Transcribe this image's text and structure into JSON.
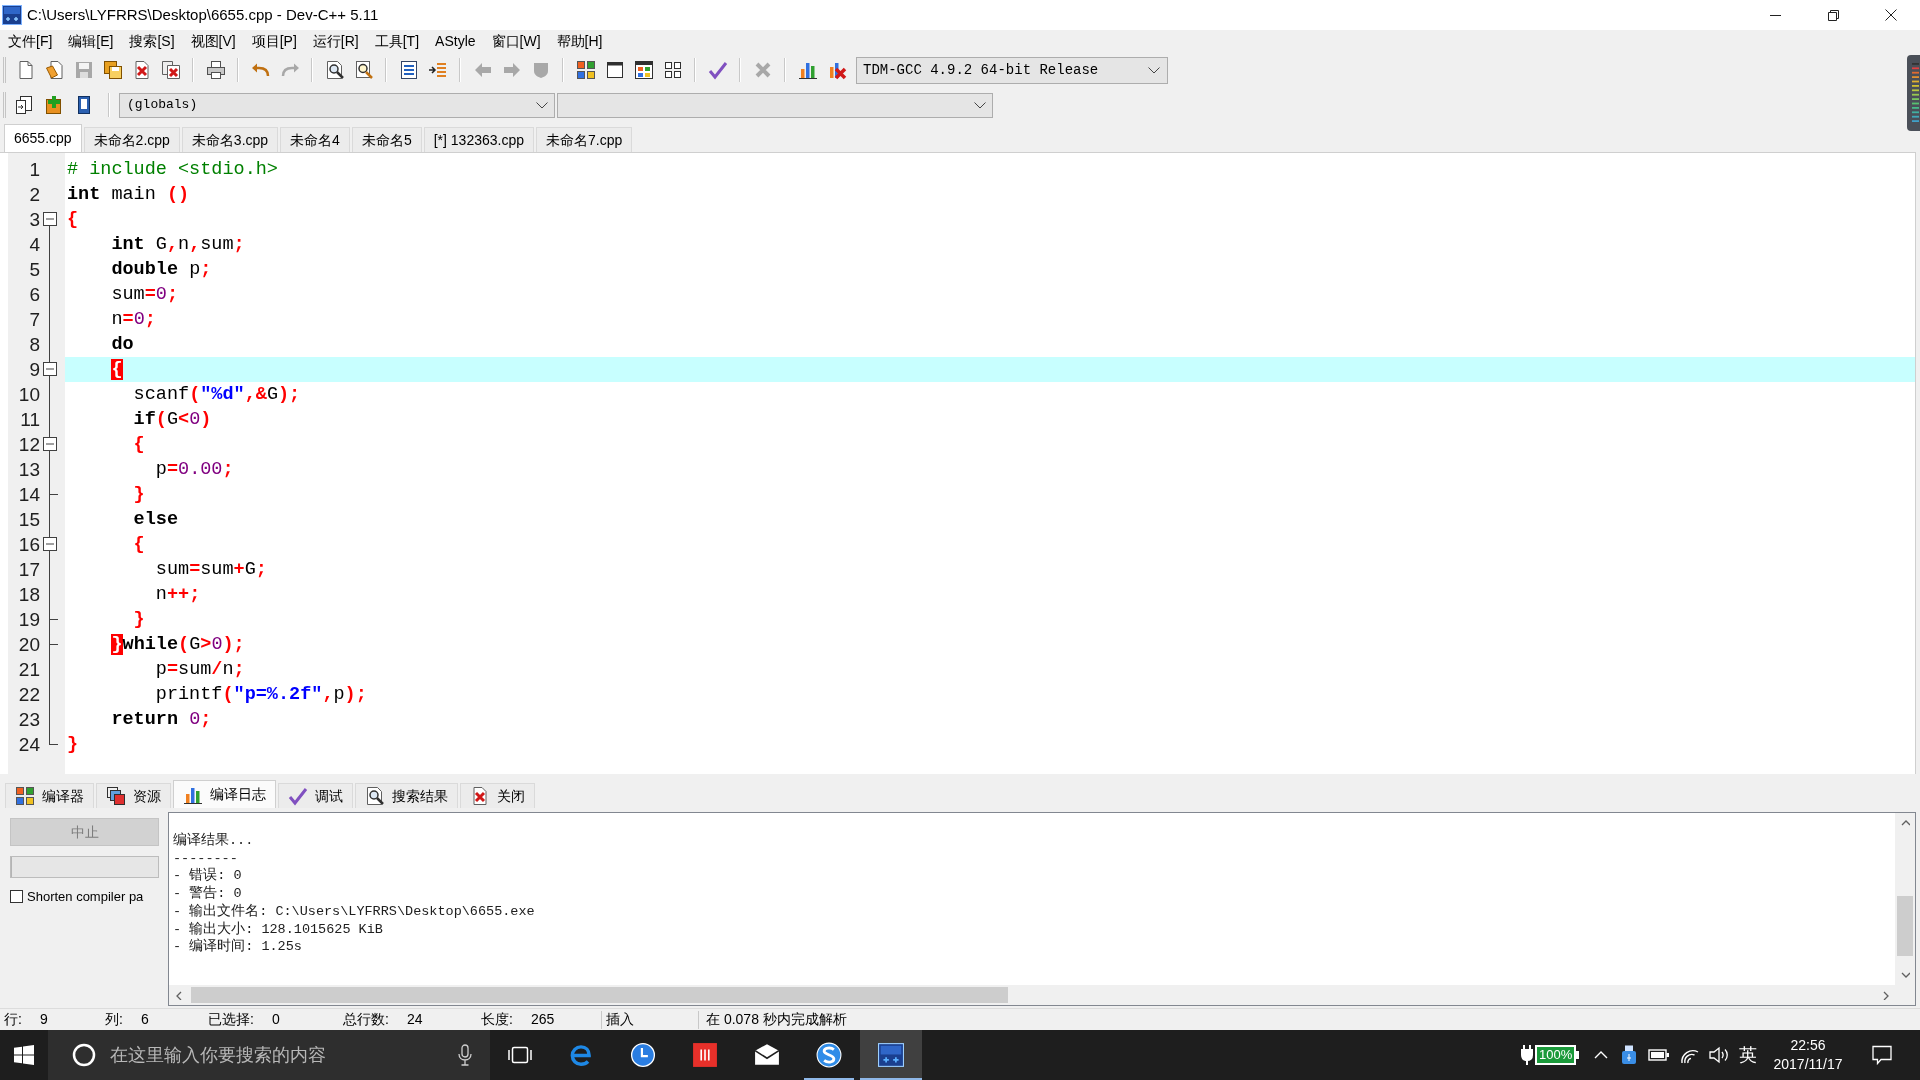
{
  "window": {
    "title": "C:\\Users\\LYFRRS\\Desktop\\6655.cpp - Dev-C++ 5.11"
  },
  "menu": [
    "文件[F]",
    "编辑[E]",
    "搜索[S]",
    "视图[V]",
    "项目[P]",
    "运行[R]",
    "工具[T]",
    "AStyle",
    "窗口[W]",
    "帮助[H]"
  ],
  "toolbar": {
    "groups": [
      [
        {
          "kind": "new",
          "disabled": false
        },
        {
          "kind": "open",
          "disabled": false
        },
        {
          "kind": "save",
          "disabled": true
        },
        {
          "kind": "save_all",
          "disabled": false
        },
        {
          "kind": "close",
          "disabled": false
        },
        {
          "kind": "close_all",
          "disabled": false
        }
      ],
      [
        {
          "kind": "print",
          "disabled": false
        }
      ],
      [
        {
          "kind": "undo",
          "disabled": false
        },
        {
          "kind": "redo",
          "disabled": true
        }
      ],
      [
        {
          "kind": "find",
          "disabled": false
        },
        {
          "kind": "replace",
          "disabled": false
        }
      ],
      [
        {
          "kind": "indent",
          "disabled": false
        },
        {
          "kind": "unindent",
          "disabled": false
        }
      ],
      [
        {
          "kind": "bookmark_prev",
          "disabled": true
        },
        {
          "kind": "bookmark_next",
          "disabled": true
        },
        {
          "kind": "bookmark_toggle",
          "disabled": true
        }
      ],
      [
        {
          "kind": "compile",
          "disabled": false
        },
        {
          "kind": "run",
          "disabled": false
        },
        {
          "kind": "compile_run",
          "disabled": false
        },
        {
          "kind": "rebuild",
          "disabled": false
        }
      ],
      [
        {
          "kind": "syntax_check",
          "disabled": false
        }
      ],
      [
        {
          "kind": "stop",
          "disabled": true
        }
      ],
      [
        {
          "kind": "profile",
          "disabled": false
        },
        {
          "kind": "delete_profile",
          "disabled": false
        }
      ]
    ],
    "compiler": "TDM-GCC 4.9.2 64-bit Release"
  },
  "toolbar_2": {
    "buttons": [
      {
        "kind": "insert",
        "disabled": false
      },
      {
        "kind": "add_file",
        "disabled": false
      },
      {
        "kind": "bookmarks",
        "disabled": false
      }
    ],
    "scope": "(globals)"
  },
  "file_tabs": [
    {
      "label": "6655.cpp",
      "selected": true
    },
    {
      "label": "未命名2.cpp",
      "selected": false
    },
    {
      "label": "未命名3.cpp",
      "selected": false
    },
    {
      "label": "未命名4",
      "selected": false
    },
    {
      "label": "未命名5",
      "selected": false
    },
    {
      "label": "[*] 132363.cpp",
      "selected": false
    },
    {
      "label": "未命名7.cpp",
      "selected": false
    }
  ],
  "editor": {
    "lines": [
      {
        "number": "1",
        "current": false,
        "kind": "plain",
        "tokens": [
          {
            "text": "# include <stdio.h>",
            "kind": "preproc"
          }
        ]
      },
      {
        "number": "2",
        "current": false,
        "kind": "plain",
        "tokens": [
          {
            "text": "int",
            "kind": "keyword"
          },
          {
            "text": " main ",
            "kind": "ident"
          },
          {
            "text": "()",
            "kind": "symbol"
          }
        ]
      },
      {
        "number": "3",
        "current": false,
        "kind": "head",
        "tokens": [
          {
            "text": "{",
            "kind": "symbol"
          }
        ]
      },
      {
        "number": "4",
        "current": false,
        "kind": "body",
        "tokens": [
          {
            "text": "    int",
            "kind": "keyword"
          },
          {
            "text": " G",
            "kind": "ident"
          },
          {
            "text": ",",
            "kind": "symbol"
          },
          {
            "text": "n",
            "kind": "ident"
          },
          {
            "text": ",",
            "kind": "symbol"
          },
          {
            "text": "sum",
            "kind": "ident"
          },
          {
            "text": ";",
            "kind": "symbol"
          }
        ]
      },
      {
        "number": "5",
        "current": false,
        "kind": "body",
        "tokens": [
          {
            "text": "    double",
            "kind": "keyword"
          },
          {
            "text": " p",
            "kind": "ident"
          },
          {
            "text": ";",
            "kind": "symbol"
          }
        ]
      },
      {
        "number": "6",
        "current": false,
        "kind": "body",
        "tokens": [
          {
            "text": "    sum",
            "kind": "ident"
          },
          {
            "text": "=",
            "kind": "symbol"
          },
          {
            "text": "0",
            "kind": "number"
          },
          {
            "text": ";",
            "kind": "symbol"
          }
        ]
      },
      {
        "number": "7",
        "current": false,
        "kind": "body",
        "tokens": [
          {
            "text": "    n",
            "kind": "ident"
          },
          {
            "text": "=",
            "kind": "symbol"
          },
          {
            "text": "0",
            "kind": "number"
          },
          {
            "text": ";",
            "kind": "symbol"
          }
        ]
      },
      {
        "number": "8",
        "current": false,
        "kind": "body",
        "tokens": [
          {
            "text": "    do",
            "kind": "keyword"
          }
        ]
      },
      {
        "number": "9",
        "current": true,
        "kind": "open",
        "tokens": [
          {
            "text": "    {",
            "kind": "matched_brace"
          }
        ]
      },
      {
        "number": "10",
        "current": false,
        "kind": "body",
        "tokens": [
          {
            "text": "      scanf",
            "kind": "ident"
          },
          {
            "text": "(",
            "kind": "symbol"
          },
          {
            "text": "\"%d\"",
            "kind": "string"
          },
          {
            "text": ",&",
            "kind": "symbol"
          },
          {
            "text": "G",
            "kind": "ident"
          },
          {
            "text": ");",
            "kind": "symbol"
          }
        ]
      },
      {
        "number": "11",
        "current": false,
        "kind": "body",
        "tokens": [
          {
            "text": "      if",
            "kind": "keyword"
          },
          {
            "text": "(",
            "kind": "symbol"
          },
          {
            "text": "G",
            "kind": "ident"
          },
          {
            "text": "<",
            "kind": "symbol"
          },
          {
            "text": "0",
            "kind": "number"
          },
          {
            "text": ")",
            "kind": "symbol"
          }
        ]
      },
      {
        "number": "12",
        "current": false,
        "kind": "open",
        "tokens": [
          {
            "text": "      {",
            "kind": "symbol"
          }
        ]
      },
      {
        "number": "13",
        "current": false,
        "kind": "body",
        "tokens": [
          {
            "text": "        p",
            "kind": "ident"
          },
          {
            "text": "=",
            "kind": "symbol"
          },
          {
            "text": "0.00",
            "kind": "number"
          },
          {
            "text": ";",
            "kind": "symbol"
          }
        ]
      },
      {
        "number": "14",
        "current": false,
        "kind": "tail",
        "tokens": [
          {
            "text": "      }",
            "kind": "symbol"
          }
        ]
      },
      {
        "number": "15",
        "current": false,
        "kind": "body",
        "tokens": [
          {
            "text": "      else",
            "kind": "keyword"
          }
        ]
      },
      {
        "number": "16",
        "current": false,
        "kind": "open",
        "tokens": [
          {
            "text": "      {",
            "kind": "symbol"
          }
        ]
      },
      {
        "number": "17",
        "current": false,
        "kind": "body",
        "tokens": [
          {
            "text": "        sum",
            "kind": "ident"
          },
          {
            "text": "=",
            "kind": "symbol"
          },
          {
            "text": "sum",
            "kind": "ident"
          },
          {
            "text": "+",
            "kind": "symbol"
          },
          {
            "text": "G",
            "kind": "ident"
          },
          {
            "text": ";",
            "kind": "symbol"
          }
        ]
      },
      {
        "number": "18",
        "current": false,
        "kind": "body",
        "tokens": [
          {
            "text": "        n",
            "kind": "ident"
          },
          {
            "text": "++;",
            "kind": "symbol"
          }
        ]
      },
      {
        "number": "19",
        "current": false,
        "kind": "tail",
        "tokens": [
          {
            "text": "      }",
            "kind": "symbol"
          }
        ]
      },
      {
        "number": "20",
        "current": false,
        "kind": "tail",
        "tokens": [
          {
            "text": "    }",
            "kind": "matched_brace"
          },
          {
            "text": "while",
            "kind": "keyword"
          },
          {
            "text": "(",
            "kind": "symbol"
          },
          {
            "text": "G",
            "kind": "ident"
          },
          {
            "text": ">",
            "kind": "symbol"
          },
          {
            "text": "0",
            "kind": "number"
          },
          {
            "text": ");",
            "kind": "symbol"
          }
        ]
      },
      {
        "number": "21",
        "current": false,
        "kind": "body",
        "tokens": [
          {
            "text": "        p",
            "kind": "ident"
          },
          {
            "text": "=",
            "kind": "symbol"
          },
          {
            "text": "sum",
            "kind": "ident"
          },
          {
            "text": "/",
            "kind": "symbol"
          },
          {
            "text": "n",
            "kind": "ident"
          },
          {
            "text": ";",
            "kind": "symbol"
          }
        ]
      },
      {
        "number": "22",
        "current": false,
        "kind": "body",
        "tokens": [
          {
            "text": "        printf",
            "kind": "ident"
          },
          {
            "text": "(",
            "kind": "symbol"
          },
          {
            "text": "\"p=%.2f\"",
            "kind": "string"
          },
          {
            "text": ",",
            "kind": "symbol"
          },
          {
            "text": "p",
            "kind": "ident"
          },
          {
            "text": ");",
            "kind": "symbol"
          }
        ]
      },
      {
        "number": "23",
        "current": false,
        "kind": "body",
        "tokens": [
          {
            "text": "    return",
            "kind": "keyword"
          },
          {
            "text": " 0",
            "kind": "number"
          },
          {
            "text": ";",
            "kind": "symbol"
          }
        ]
      },
      {
        "number": "24",
        "current": false,
        "kind": "last",
        "tokens": [
          {
            "text": "}",
            "kind": "symbol"
          }
        ]
      }
    ]
  },
  "bottom_tabs": [
    {
      "kind": "compiler",
      "label": "编译器",
      "selected": false
    },
    {
      "kind": "resources",
      "label": "资源",
      "selected": false
    },
    {
      "kind": "compile_log",
      "label": "编译日志",
      "selected": true
    },
    {
      "kind": "debug",
      "label": "调试",
      "selected": false
    },
    {
      "kind": "search_results",
      "label": "搜索结果",
      "selected": false
    },
    {
      "kind": "close",
      "label": "关闭",
      "selected": false
    }
  ],
  "compile_panel": {
    "abort_button": {
      "label": "中止",
      "disabled": true
    },
    "progress": {
      "level": 0
    },
    "shorten_paths": {
      "label": "Shorten compiler pa",
      "checked": false
    },
    "log": [
      "编译结果...",
      "--------",
      "- 错误: 0",
      "- 警告: 0",
      "- 输出文件名: C:\\Users\\LYFRRS\\Desktop\\6655.exe",
      "- 输出大小: 128.1015625 KiB",
      "- 编译时间: 1.25s"
    ]
  },
  "status_bar": {
    "fields": [
      {
        "label": "行:",
        "value": "9"
      },
      {
        "label": "列:",
        "value": "6"
      },
      {
        "label": "已选择:",
        "value": "0"
      },
      {
        "label": "总行数:",
        "value": "24"
      },
      {
        "label": "长度:",
        "value": "265"
      }
    ],
    "mode": "插入",
    "message": "在 0.078 秒内完成解析"
  },
  "taskbar": {
    "search": {
      "placeholder": "在这里输入你要搜索的内容"
    },
    "apps": [
      {
        "kind": "browser",
        "running": false,
        "selected": false
      },
      {
        "kind": "clock",
        "running": false,
        "selected": false
      },
      {
        "kind": "media",
        "running": false,
        "selected": false
      },
      {
        "kind": "mail",
        "running": false,
        "selected": false
      },
      {
        "kind": "input",
        "running": true,
        "selected": false
      },
      {
        "kind": "ide",
        "running": true,
        "selected": true
      }
    ],
    "battery": "100%",
    "input_method": "英",
    "time": "22:56",
    "date": "2017/11/17"
  }
}
